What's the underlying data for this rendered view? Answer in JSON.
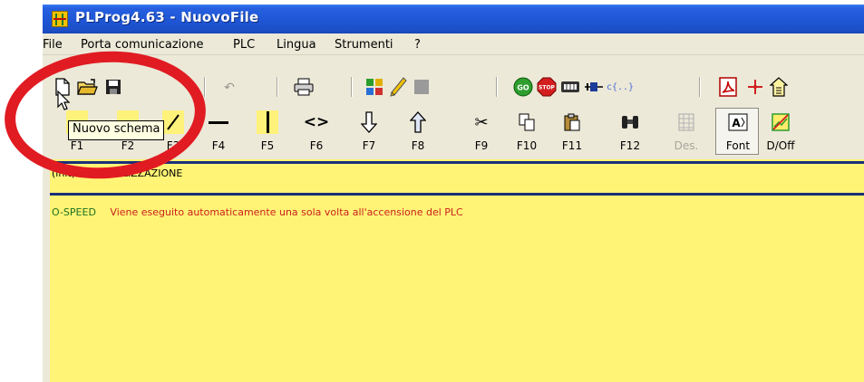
{
  "window": {
    "title": "PLProg4.63 - NuovoFile"
  },
  "menu": {
    "items": [
      "File",
      "Porta comunicazione",
      "PLC",
      "Lingua",
      "Strumenti",
      "?"
    ]
  },
  "toolbar1": {
    "buttons": [
      {
        "name": "new-file",
        "icon": "page-icon"
      },
      {
        "name": "open-file",
        "icon": "folder-icon"
      },
      {
        "name": "save-file",
        "icon": "floppy-icon"
      },
      {
        "name": "undo",
        "icon": "undo-icon"
      },
      {
        "name": "print",
        "icon": "printer-icon"
      },
      {
        "name": "layout",
        "icon": "grid-icon"
      },
      {
        "name": "pen",
        "icon": "pencil-icon"
      },
      {
        "name": "stop-square",
        "icon": "square-icon"
      },
      {
        "name": "go",
        "icon": "go-icon",
        "label": "GO"
      },
      {
        "name": "stop",
        "icon": "stop-icon",
        "label": "STOP"
      },
      {
        "name": "monitor",
        "icon": "monitor-icon"
      },
      {
        "name": "connect",
        "icon": "plug-icon"
      },
      {
        "name": "code",
        "icon": "code-icon",
        "label": "c{..}"
      },
      {
        "name": "pdf",
        "icon": "pdf-icon"
      },
      {
        "name": "move",
        "icon": "crosshair-icon"
      },
      {
        "name": "properties",
        "icon": "house-doc-icon"
      }
    ]
  },
  "toolbar2": {
    "keys": [
      {
        "label": "F1",
        "icon": "contact-no-icon"
      },
      {
        "label": "F2",
        "icon": "contact-nc-icon"
      },
      {
        "label": "F3",
        "icon": "contact-diag-icon"
      },
      {
        "label": "F4",
        "icon": "hline-icon"
      },
      {
        "label": "F5",
        "icon": "vline-icon"
      },
      {
        "label": "F6",
        "icon": "coil-icon"
      },
      {
        "label": "F7",
        "icon": "arrow-down-icon"
      },
      {
        "label": "F8",
        "icon": "arrow-up-icon"
      },
      {
        "label": "F9",
        "icon": "scissors-icon"
      },
      {
        "label": "F10",
        "icon": "copy-icon"
      },
      {
        "label": "F11",
        "icon": "paste-icon"
      },
      {
        "label": "F12",
        "icon": "binoculars-icon"
      },
      {
        "label": "Des.",
        "icon": "grid-disabled-icon"
      },
      {
        "label": "Font",
        "icon": "font-icon"
      },
      {
        "label": "D/Off",
        "icon": "chart-off-icon"
      }
    ]
  },
  "tooltip": {
    "text": "Nuovo schema"
  },
  "editor": {
    "rung_title": "(init) DI INIZIALIZZAZIONE",
    "comment_tag": "O-SPEED",
    "comment_text": "Viene eseguito automaticamente una sola volta  all'accensione del PLC"
  },
  "colors": {
    "titlebar": "#1f57d6",
    "editor_bg": "#fff475",
    "annotation_ring": "#e11b22",
    "comment_tag": "#1f6f20",
    "comment_text": "#cc1f1f"
  }
}
